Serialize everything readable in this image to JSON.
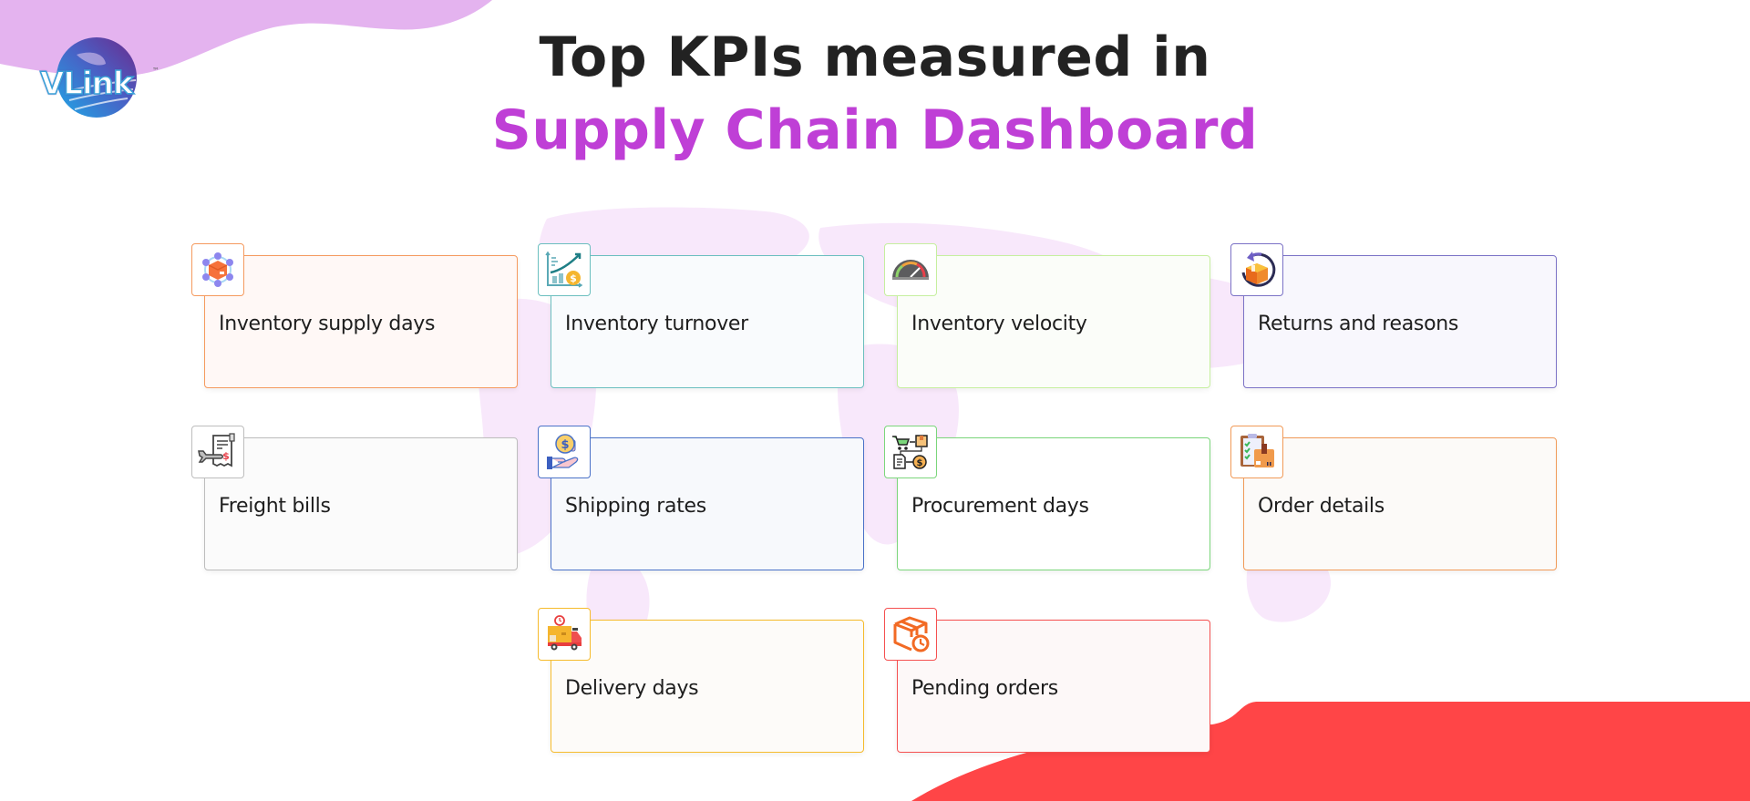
{
  "brand": {
    "logo_text": "VLink",
    "trademark": "™",
    "colors": {
      "purple_wave": "#e4b3ef",
      "red_wave": "#ff4547",
      "map_tint": "#f8e8fb",
      "title_dark": "#222222",
      "title_accent": "#bf3fd6"
    }
  },
  "header": {
    "title_line1": "Top KPIs measured in",
    "title_line2": "Supply Chain Dashboard"
  },
  "kpis": [
    {
      "label": "Inventory supply days",
      "icon": "inventory-network-icon",
      "border": "#f59a5e",
      "bg": "#fff8f6"
    },
    {
      "label": "Inventory turnover",
      "icon": "growth-chart-dollar-icon",
      "border": "#6bbfbf",
      "bg": "#f9fbfd"
    },
    {
      "label": "Inventory velocity",
      "icon": "speedometer-icon",
      "border": "#c6ef9f",
      "bg": "#fbfdf9"
    },
    {
      "label": "Returns and reasons",
      "icon": "box-return-icon",
      "border": "#7b72c6",
      "bg": "#f8f7fd"
    },
    {
      "label": "Freight bills",
      "icon": "freight-bill-icon",
      "border": "#bdbdbd",
      "bg": "#fbfbfb"
    },
    {
      "label": "Shipping rates",
      "icon": "hand-coin-icon",
      "border": "#4a72c8",
      "bg": "#f7f9fc"
    },
    {
      "label": "Procurement days",
      "icon": "procurement-flow-icon",
      "border": "#7bd67b",
      "bg": "#ffffff"
    },
    {
      "label": "Order details",
      "icon": "clipboard-box-icon",
      "border": "#f19a58",
      "bg": "#fcfaf8"
    },
    {
      "label": "Delivery days",
      "icon": "delivery-truck-icon",
      "border": "#f6bb2c",
      "bg": "#fdfbf9"
    },
    {
      "label": "Pending orders",
      "icon": "box-clock-icon",
      "border": "#f55050",
      "bg": "#fdf8f8"
    }
  ]
}
